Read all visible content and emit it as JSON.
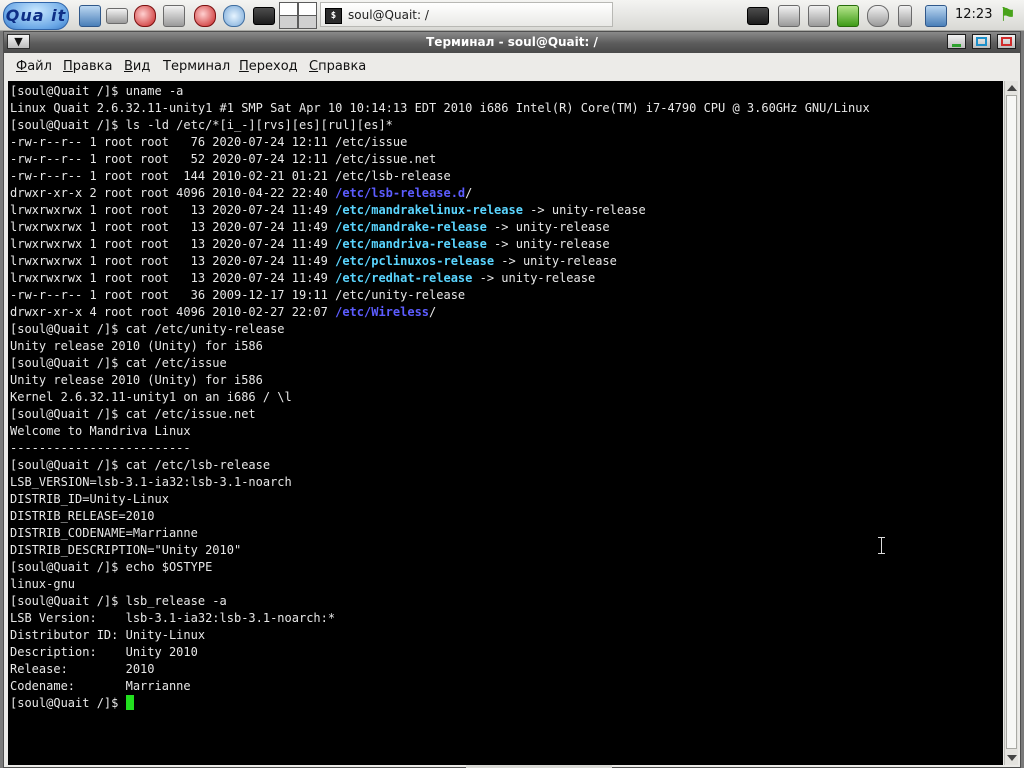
{
  "panel": {
    "logo_text": "Qua it",
    "launchers": [
      "computer-icon",
      "drive-icon",
      "toolbox-icon",
      "tools-icon",
      "mail-icon",
      "globe-icon",
      "terminal-icon"
    ],
    "task_title": "soul@Quait: /",
    "tray_icons": [
      "monitor-icon",
      "network-icon",
      "printer-icon",
      "update-icon",
      "settings-icon",
      "battery-icon",
      "users-icon"
    ],
    "clock": "12:23"
  },
  "window": {
    "title": "Терминал - soul@Quait: /",
    "menus": [
      {
        "key": "Ф",
        "rest": "айл"
      },
      {
        "key": "П",
        "rest": "равка"
      },
      {
        "key": "В",
        "rest": "ид"
      },
      {
        "key": "",
        "rest": "Терминал"
      },
      {
        "key": "П",
        "rest": "ереход"
      },
      {
        "key": "С",
        "rest": "правка"
      }
    ]
  },
  "terminal": {
    "lines": [
      [
        {
          "t": "[soul@Quait /]$ uname -a"
        }
      ],
      [
        {
          "t": "Linux Quait 2.6.32.11-unity1 #1 SMP Sat Apr 10 10:14:13 EDT 2010 i686 Intel(R) Core(TM) i7-4790 CPU @ 3.60GHz GNU/Linux"
        }
      ],
      [
        {
          "t": "[soul@Quait /]$ ls -ld /etc/*[i_-][rvs][es][rul][es]*"
        }
      ],
      [
        {
          "t": "-rw-r--r-- 1 root root   76 2020-07-24 12:11 /etc/issue"
        }
      ],
      [
        {
          "t": "-rw-r--r-- 1 root root   52 2020-07-24 12:11 /etc/issue.net"
        }
      ],
      [
        {
          "t": "-rw-r--r-- 1 root root  144 2010-02-21 01:21 /etc/lsb-release"
        }
      ],
      [
        {
          "t": "drwxr-xr-x 2 root root 4096 2010-04-22 22:40 "
        },
        {
          "t": "/etc/lsb-release.d",
          "c": "blue"
        },
        {
          "t": "/"
        }
      ],
      [
        {
          "t": "lrwxrwxrwx 1 root root   13 2020-07-24 11:49 "
        },
        {
          "t": "/etc/mandrakelinux-release",
          "c": "cyan"
        },
        {
          "t": " -> unity-release"
        }
      ],
      [
        {
          "t": "lrwxrwxrwx 1 root root   13 2020-07-24 11:49 "
        },
        {
          "t": "/etc/mandrake-release",
          "c": "cyan"
        },
        {
          "t": " -> unity-release"
        }
      ],
      [
        {
          "t": "lrwxrwxrwx 1 root root   13 2020-07-24 11:49 "
        },
        {
          "t": "/etc/mandriva-release",
          "c": "cyan"
        },
        {
          "t": " -> unity-release"
        }
      ],
      [
        {
          "t": "lrwxrwxrwx 1 root root   13 2020-07-24 11:49 "
        },
        {
          "t": "/etc/pclinuxos-release",
          "c": "cyan"
        },
        {
          "t": " -> unity-release"
        }
      ],
      [
        {
          "t": "lrwxrwxrwx 1 root root   13 2020-07-24 11:49 "
        },
        {
          "t": "/etc/redhat-release",
          "c": "cyan"
        },
        {
          "t": " -> unity-release"
        }
      ],
      [
        {
          "t": "-rw-r--r-- 1 root root   36 2009-12-17 19:11 /etc/unity-release"
        }
      ],
      [
        {
          "t": "drwxr-xr-x 4 root root 4096 2010-02-27 22:07 "
        },
        {
          "t": "/etc/Wireless",
          "c": "blue"
        },
        {
          "t": "/"
        }
      ],
      [
        {
          "t": "[soul@Quait /]$ cat /etc/unity-release"
        }
      ],
      [
        {
          "t": "Unity release 2010 (Unity) for i586"
        }
      ],
      [
        {
          "t": "[soul@Quait /]$ cat /etc/issue"
        }
      ],
      [
        {
          "t": "Unity release 2010 (Unity) for i586"
        }
      ],
      [
        {
          "t": "Kernel 2.6.32.11-unity1 on an i686 / \\l"
        }
      ],
      [
        {
          "t": "[soul@Quait /]$ cat /etc/issue.net"
        }
      ],
      [
        {
          "t": "Welcome to Mandriva Linux"
        }
      ],
      [
        {
          "t": "-------------------------"
        }
      ],
      [
        {
          "t": "[soul@Quait /]$ cat /etc/lsb-release"
        }
      ],
      [
        {
          "t": "LSB_VERSION=lsb-3.1-ia32:lsb-3.1-noarch"
        }
      ],
      [
        {
          "t": "DISTRIB_ID=Unity-Linux"
        }
      ],
      [
        {
          "t": "DISTRIB_RELEASE=2010"
        }
      ],
      [
        {
          "t": "DISTRIB_CODENAME=Marrianne"
        }
      ],
      [
        {
          "t": "DISTRIB_DESCRIPTION=\"Unity 2010\""
        }
      ],
      [
        {
          "t": "[soul@Quait /]$ echo $OSTYPE"
        }
      ],
      [
        {
          "t": "linux-gnu"
        }
      ],
      [
        {
          "t": "[soul@Quait /]$ lsb_release -a"
        }
      ],
      [
        {
          "t": "LSB Version:    lsb-3.1-ia32:lsb-3.1-noarch:*"
        }
      ],
      [
        {
          "t": "Distributor ID: Unity-Linux"
        }
      ],
      [
        {
          "t": "Description:    Unity 2010"
        }
      ],
      [
        {
          "t": "Release:        2010"
        }
      ],
      [
        {
          "t": "Codename:       Marrianne"
        }
      ],
      [
        {
          "t": "[soul@Quait /]$ "
        }
      ]
    ],
    "colors": {
      "background": "#000000",
      "text": "#e8e8e8",
      "directory": "#5c5cff",
      "symlink": "#5ad5ff",
      "cursor": "#22e01f"
    }
  }
}
